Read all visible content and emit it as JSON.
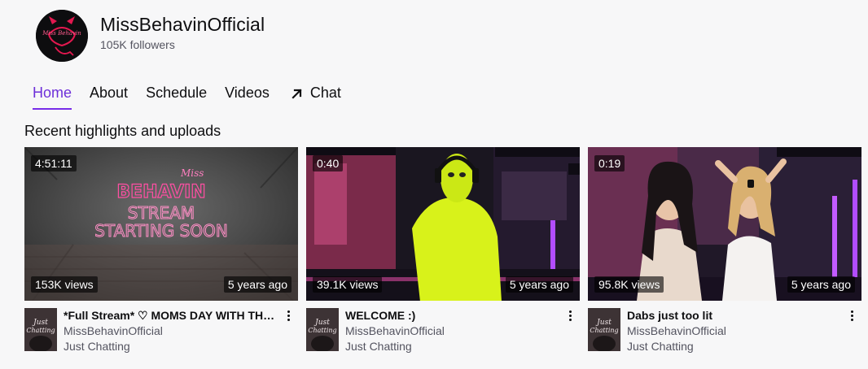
{
  "channel": {
    "name": "MissBehavinOfficial",
    "followers": "105K followers",
    "avatar_text": "Miss Behavin"
  },
  "tabs": [
    {
      "label": "Home",
      "active": true
    },
    {
      "label": "About",
      "active": false
    },
    {
      "label": "Schedule",
      "active": false
    },
    {
      "label": "Videos",
      "active": false
    },
    {
      "label": "Chat",
      "active": false,
      "icon": "external-arrow-icon"
    }
  ],
  "section_title": "Recent highlights and uploads",
  "videos": [
    {
      "duration": "4:51:11",
      "views": "153K views",
      "age": "5 years ago",
      "title": "*Full Stream* ♡ MOMS DAY WITH THE SQUAD ♡",
      "channel": "MissBehavinOfficial",
      "category": "Just Chatting",
      "thumb_text": [
        "Miss",
        "BEHAVIN",
        "STREAM",
        "STARTING SOON"
      ]
    },
    {
      "duration": "0:40",
      "views": "39.1K views",
      "age": "5 years ago",
      "title": "WELCOME :)",
      "channel": "MissBehavinOfficial",
      "category": "Just Chatting"
    },
    {
      "duration": "0:19",
      "views": "95.8K views",
      "age": "5 years ago",
      "title": "Dabs just too lit",
      "channel": "MissBehavinOfficial",
      "category": "Just Chatting"
    }
  ],
  "category_art_text": [
    "Just",
    "Chatting"
  ],
  "colors": {
    "accent": "#772ce8",
    "neon_pink": "#ff4fa3",
    "background": "#f7f7f8"
  }
}
